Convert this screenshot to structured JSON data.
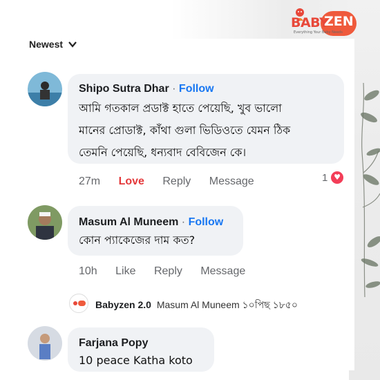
{
  "logo": {
    "brand_left": "BABY",
    "brand_right": "ZEN",
    "tagline": "Everything Your Baby Needs"
  },
  "sort": {
    "label": "Newest"
  },
  "comments": [
    {
      "name": "Shipo Sutra Dhar",
      "separator": "·",
      "follow": "Follow",
      "lines": [
        "আমি গতকাল প্রডাক্ট হাতে পেয়েছি, খুব ভালো",
        "মানের প্রোডাক্ট, কাঁথা গুলা ভিডিওতে যেমন ঠিক",
        "তেমনি পেয়েছি, ধন্যবাদ বেবিজেন কে।"
      ],
      "time": "27m",
      "like": "Love",
      "reply": "Reply",
      "message": "Message",
      "reaction_count": "1"
    },
    {
      "name": "Masum Al Muneem",
      "separator": "·",
      "follow": "Follow",
      "lines": [
        "কোন প্যাকেজের দাম কত?"
      ],
      "time": "10h",
      "like": "Like",
      "reply": "Reply",
      "message": "Message"
    },
    {
      "name": "Farjana Popy",
      "lines": [
        "10 peace Katha koto"
      ]
    }
  ],
  "reply": {
    "author": "Babyzen 2.0",
    "text": "Masum Al Muneem ১০পিছ ১৮৫০"
  },
  "colors": {
    "follow": "#1877f2",
    "love": "#e4383a",
    "bubble": "#f0f2f5",
    "brand": "#ef5a3c"
  }
}
